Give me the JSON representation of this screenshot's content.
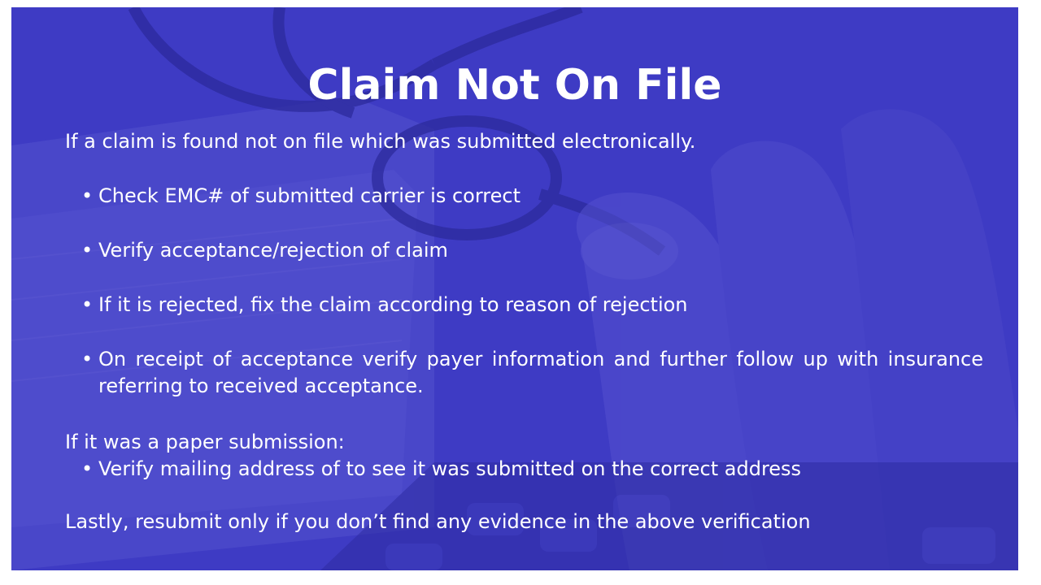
{
  "slide": {
    "title": "Claim Not On File",
    "intro": "If a claim is found not on file which was submitted electronically.",
    "electronic_bullets": [
      "Check EMC# of submitted carrier is correct",
      "Verify acceptance/rejection of claim",
      "If it is rejected, fix the claim according to reason of rejection"
    ],
    "acceptance_bullet": {
      "line1": "On receipt of acceptance verify payer information and further follow up with insurance",
      "line2": "referring to received acceptance."
    },
    "paper_heading": "If it was a paper submission:",
    "paper_bullets": [
      "Verify mailing address of to see it was submitted on the correct address"
    ],
    "closing": "Lastly, resubmit only if you don’t find any evidence in the above verification",
    "bullet_glyph": "•"
  },
  "colors": {
    "overlay": "#3e3bc4",
    "text": "#ffffff",
    "page_border": "#ffffff"
  },
  "icons": {
    "bullet": "bullet-dot-icon"
  }
}
